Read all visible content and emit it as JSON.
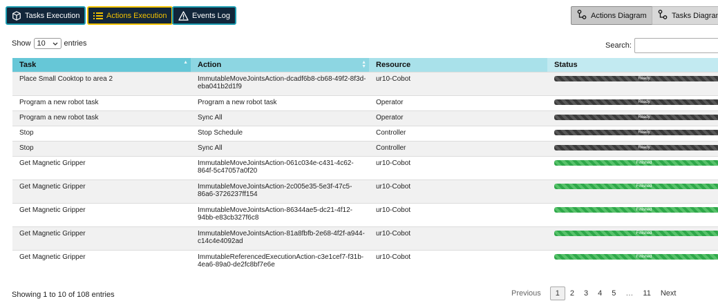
{
  "toolbar": {
    "tasks_label": "Tasks Execution",
    "actions_label": "Actions Execution",
    "events_label": "Events Log",
    "actions_diagram_label": "Actions Diagram",
    "tasks_diagram_label": "Tasks Diagram"
  },
  "controls": {
    "show_label": "Show",
    "entries_value": "10",
    "entries_label": "entries",
    "search_label": "Search:",
    "search_value": ""
  },
  "table": {
    "headers": {
      "task": "Task",
      "action": "Action",
      "resource": "Resource",
      "status": "Status"
    },
    "rows": [
      {
        "task": "Place Small Cooktop to area 2",
        "action": "ImmutableMoveJointsAction-dcadf6b8-cb68-49f2-8f3d-eba041b2d1f9",
        "resource": "ur10-Cobot",
        "status": "Ready"
      },
      {
        "task": "Program a new robot task",
        "action": "Program a new robot task",
        "resource": "Operator",
        "status": "Ready"
      },
      {
        "task": "Program a new robot task",
        "action": "Sync All",
        "resource": "Operator",
        "status": "Ready"
      },
      {
        "task": "Stop",
        "action": "Stop Schedule",
        "resource": "Controller",
        "status": "Ready"
      },
      {
        "task": "Stop",
        "action": "Sync All",
        "resource": "Controller",
        "status": "Ready"
      },
      {
        "task": "Get Magnetic Gripper",
        "action": "ImmutableMoveJointsAction-061c034e-c431-4c62-864f-5c47057a0f20",
        "resource": "ur10-Cobot",
        "status": "Finished"
      },
      {
        "task": "Get Magnetic Gripper",
        "action": "ImmutableMoveJointsAction-2c005e35-5e3f-47c5-86a6-3726237ff154",
        "resource": "ur10-Cobot",
        "status": "Finished"
      },
      {
        "task": "Get Magnetic Gripper",
        "action": "ImmutableMoveJointsAction-86344ae5-dc21-4f12-94bb-e83cb327f6c8",
        "resource": "ur10-Cobot",
        "status": "Finished"
      },
      {
        "task": "Get Magnetic Gripper",
        "action": "ImmutableMoveJointsAction-81a8fbfb-2e68-4f2f-a944-c14c4e4092ad",
        "resource": "ur10-Cobot",
        "status": "Finished"
      },
      {
        "task": "Get Magnetic Gripper",
        "action": "ImmutableReferencedExecutionAction-c3e1cef7-f31b-4ea6-89a0-de2fc8bf7e6e",
        "resource": "ur10-Cobot",
        "status": "Finished"
      }
    ]
  },
  "footer": {
    "info": "Showing 1 to 10 of 108 entries",
    "previous": "Previous",
    "pages": [
      "1",
      "2",
      "3",
      "4",
      "5",
      "…",
      "11"
    ],
    "current_page": "1",
    "next": "Next"
  },
  "colors": {
    "toolbar_bg": "#12263a",
    "active_accent": "#f2c200",
    "header_teal": "#66c7d7",
    "ready_bar": "#3a3a3a",
    "finished_bar": "#2fa84a"
  }
}
